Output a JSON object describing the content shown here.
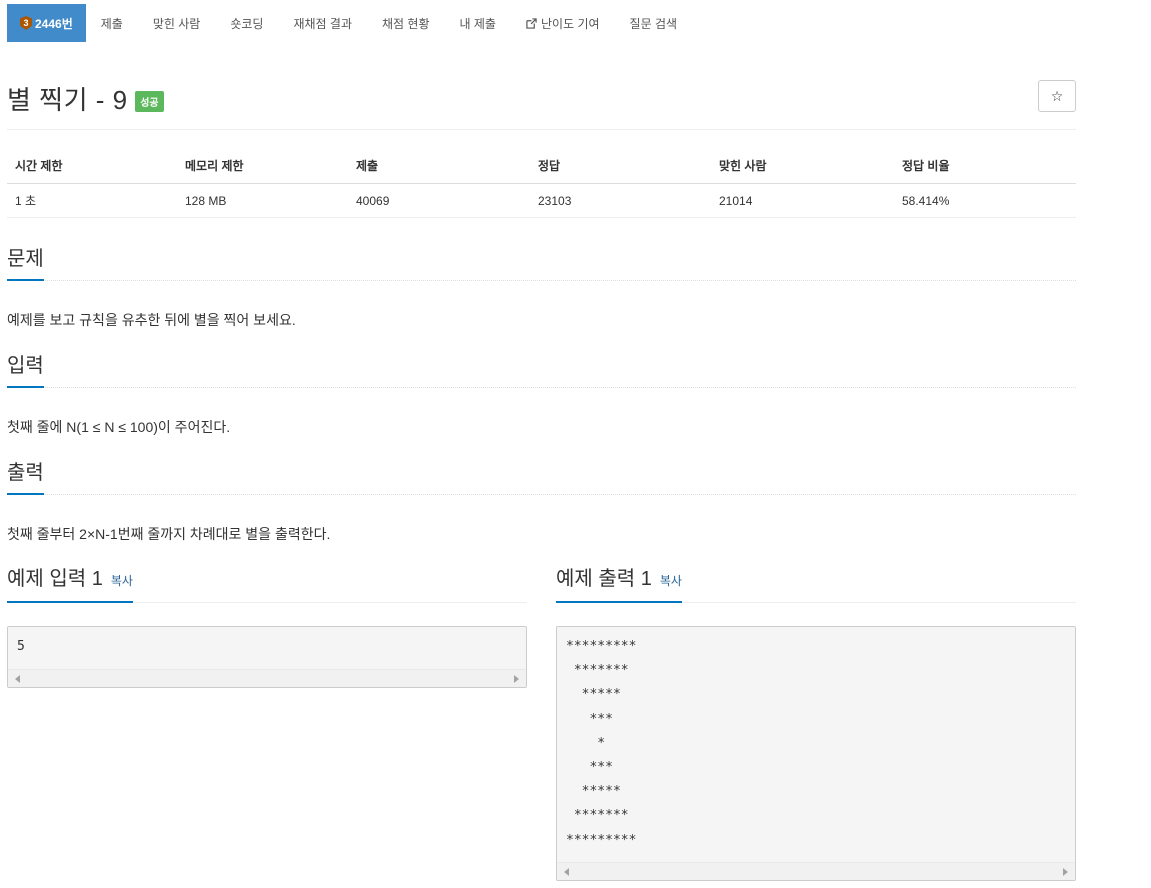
{
  "nav": {
    "problem_tier": "3",
    "items": [
      {
        "label": "2446번",
        "active": true
      },
      {
        "label": "제출"
      },
      {
        "label": "맞힌 사람"
      },
      {
        "label": "숏코딩"
      },
      {
        "label": "재채점 결과"
      },
      {
        "label": "채점 현황"
      },
      {
        "label": "내 제출"
      },
      {
        "label": "난이도 기여",
        "icon": "external-link-icon"
      },
      {
        "label": "질문 검색"
      }
    ]
  },
  "problem": {
    "title": "별 찍기 - 9",
    "status": "성공",
    "star_icon": "☆"
  },
  "info_table": {
    "headers": [
      "시간 제한",
      "메모리 제한",
      "제출",
      "정답",
      "맞힌 사람",
      "정답 비율"
    ],
    "values": [
      "1 초",
      "128 MB",
      "40069",
      "23103",
      "21014",
      "58.414%"
    ]
  },
  "sections": {
    "description": {
      "title": "문제",
      "text": "예제를 보고 규칙을 유추한 뒤에 별을 찍어 보세요."
    },
    "input": {
      "title": "입력",
      "text": "첫째 줄에 N(1 ≤ N ≤ 100)이 주어진다."
    },
    "output": {
      "title": "출력",
      "text": "첫째 줄부터 2×N-1번째 줄까지 차례대로 별을 출력한다."
    }
  },
  "samples": {
    "copy_label": "복사",
    "input": {
      "title": "예제 입력 1",
      "content": "5"
    },
    "output": {
      "title": "예제 출력 1",
      "content": "*********\n *******\n  *****\n   ***\n    *\n   ***\n  *****\n *******\n*********"
    }
  },
  "colors": {
    "nav_active": "#428bca",
    "status_success": "#5cb85c",
    "section_underline": "#0076c0",
    "tier_bronze": "#ad5600"
  }
}
